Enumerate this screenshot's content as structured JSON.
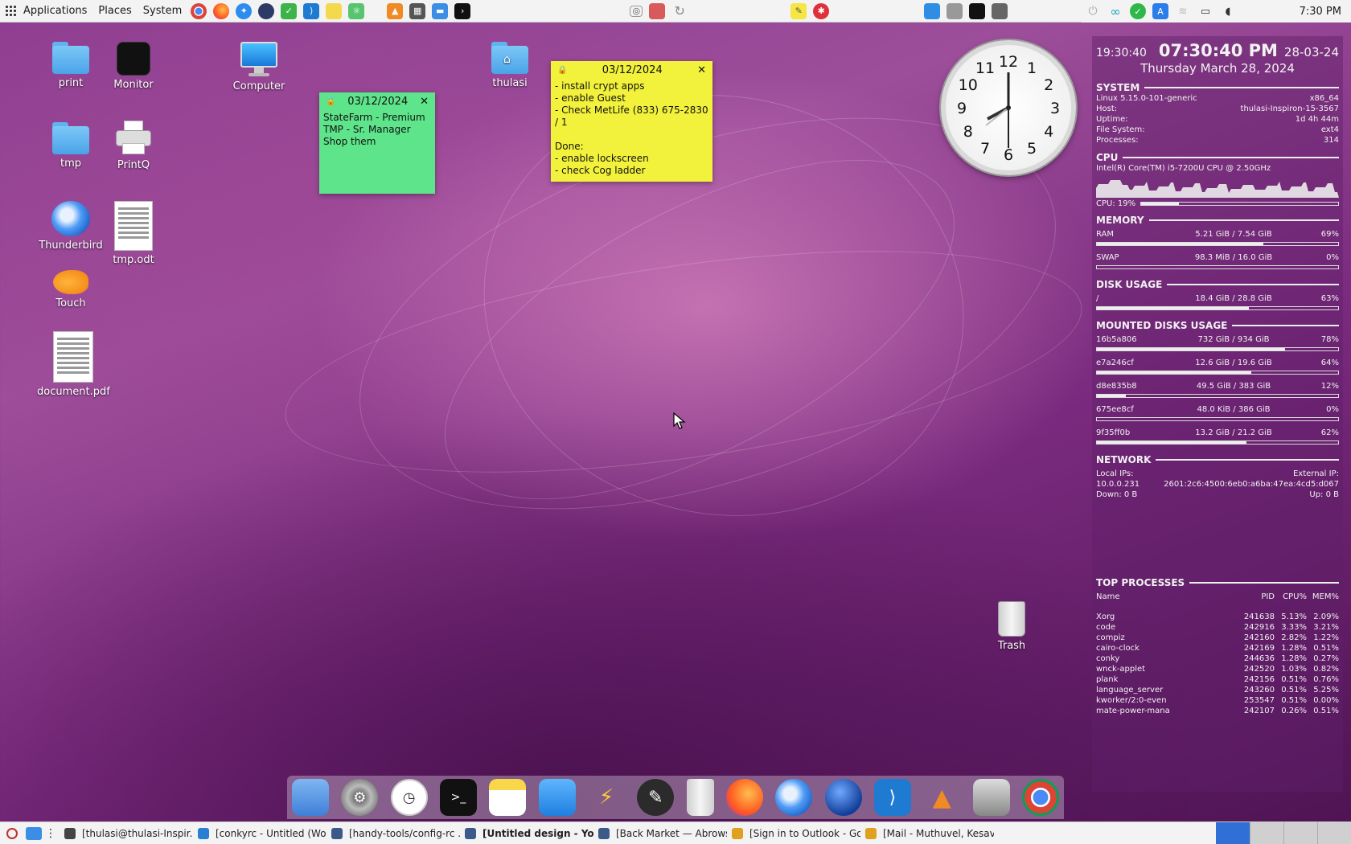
{
  "top_panel": {
    "applications_label": "Applications",
    "places_label": "Places",
    "system_label": "System",
    "clock": "7:30 PM"
  },
  "desktop_icons": {
    "print": "print",
    "monitor": "Monitor",
    "computer": "Computer",
    "thulasi": "thulasi",
    "tmp": "tmp",
    "printq": "PrintQ",
    "thunderbird": "Thunderbird",
    "tmp_odt": "tmp.odt",
    "touch": "Touch",
    "document_pdf": "document.pdf",
    "trash": "Trash"
  },
  "notes": {
    "green": {
      "date": "03/12/2024",
      "text": "StateFarm - Premium\nTMP - Sr. Manager\nShop them",
      "color": "#5ee48a"
    },
    "yellow": {
      "date": "03/12/2024",
      "text": "- install crypt apps\n- enable Guest\n- Check MetLife (833) 675-2830 / 1\n\nDone:\n- enable lockscreen\n- check Cog ladder",
      "color": "#f2f23c"
    }
  },
  "analog_clock": {
    "numbers": [
      "12",
      "1",
      "2",
      "3",
      "4",
      "5",
      "6",
      "7",
      "8",
      "9",
      "10",
      "11"
    ]
  },
  "conky": {
    "time_24": "19:30:40",
    "time_12": "07:30:40 PM",
    "date_short": "28-03-24",
    "date_long": "Thursday March 28, 2024",
    "system": {
      "title": "SYSTEM",
      "kernel": "Linux 5.15.0-101-generic",
      "arch": "x86_64",
      "host_label": "Host:",
      "host": "thulasi-Inspiron-15-3567",
      "uptime_label": "Uptime:",
      "uptime": "1d 4h 44m",
      "fs_label": "File System:",
      "fs": "ext4",
      "proc_label": "Processes:",
      "processes": "314"
    },
    "cpu": {
      "title": "CPU",
      "model": "Intel(R) Core(TM) i5-7200U CPU @ 2.50GHz",
      "usage_label": "CPU: 19%",
      "usage": 19
    },
    "memory": {
      "title": "MEMORY",
      "ram_label": "RAM",
      "ram_value": "5.21 GiB / 7.54 GiB",
      "ram_pct": "69%",
      "ram_fill": 69,
      "swap_label": "SWAP",
      "swap_value": "98.3 MiB / 16.0 GiB",
      "swap_pct": "0%",
      "swap_fill": 0
    },
    "disk": {
      "title": "DISK USAGE",
      "root_label": "/",
      "root_value": "18.4 GiB / 28.8 GiB",
      "root_pct": "63%",
      "root_fill": 63
    },
    "mounted": {
      "title": "MOUNTED DISKS USAGE",
      "disks": [
        {
          "name": "16b5a806",
          "value": "732 GiB / 934 GiB",
          "pct": "78%",
          "fill": 78
        },
        {
          "name": "e7a246cf",
          "value": "12.6 GiB / 19.6 GiB",
          "pct": "64%",
          "fill": 64
        },
        {
          "name": "d8e835b8",
          "value": "49.5 GiB / 383 GiB",
          "pct": "12%",
          "fill": 12
        },
        {
          "name": "675ee8cf",
          "value": "48.0 KiB / 386 GiB",
          "pct": "0%",
          "fill": 0
        },
        {
          "name": "9f35ff0b",
          "value": "13.2 GiB / 21.2 GiB",
          "pct": "62%",
          "fill": 62
        }
      ]
    },
    "network": {
      "title": "NETWORK",
      "local_label": "Local IPs:",
      "external_label": "External IP:",
      "local_ip": "10.0.0.231",
      "external_ip": "2601:2c6:4500:6eb0:a6ba:47ea:4cd5:d067",
      "down": "Down: 0 B",
      "up": "Up: 0 B"
    },
    "top": {
      "title": "TOP PROCESSES",
      "headers": {
        "name": "Name",
        "pid": "PID",
        "cpu": "CPU%",
        "mem": "MEM%"
      },
      "rows": [
        {
          "name": "Xorg",
          "pid": "241638",
          "cpu": "5.13%",
          "mem": "2.09%"
        },
        {
          "name": "code",
          "pid": "242916",
          "cpu": "3.33%",
          "mem": "3.21%"
        },
        {
          "name": "compiz",
          "pid": "242160",
          "cpu": "2.82%",
          "mem": "1.22%"
        },
        {
          "name": "cairo-clock",
          "pid": "242169",
          "cpu": "1.28%",
          "mem": "0.51%"
        },
        {
          "name": "conky",
          "pid": "244636",
          "cpu": "1.28%",
          "mem": "0.27%"
        },
        {
          "name": "wnck-applet",
          "pid": "242520",
          "cpu": "1.03%",
          "mem": "0.82%"
        },
        {
          "name": "plank",
          "pid": "242156",
          "cpu": "0.51%",
          "mem": "0.76%"
        },
        {
          "name": "language_server",
          "pid": "243260",
          "cpu": "0.51%",
          "mem": "5.25%"
        },
        {
          "name": "kworker/2:0-even",
          "pid": "253547",
          "cpu": "0.51%",
          "mem": "0.00%"
        },
        {
          "name": "mate-power-mana",
          "pid": "242107",
          "cpu": "0.26%",
          "mem": "0.51%"
        }
      ]
    }
  },
  "taskbar": {
    "tasks": [
      {
        "label": "[thulasi@thulasi-Inspir...",
        "icon": "terminal-icon",
        "color": "#444444"
      },
      {
        "label": "[conkyrc - Untitled (Wor...",
        "icon": "vscode-icon",
        "color": "#2a7fd4"
      },
      {
        "label": "[handy-tools/config-rc ...",
        "icon": "browser-icon",
        "color": "#3b5a8a"
      },
      {
        "label": "[Untitled design - Your ...",
        "icon": "browser-icon",
        "color": "#3b5a8a"
      },
      {
        "label": "[Back Market — Abrows...",
        "icon": "browser-icon",
        "color": "#3b5a8a"
      },
      {
        "label": "[Sign in to Outlook - Go...",
        "icon": "chrome-icon",
        "color": "#e0a020"
      },
      {
        "label": "[Mail - Muthuvel, Kesav...",
        "icon": "chrome-icon",
        "color": "#e0a020"
      }
    ]
  }
}
